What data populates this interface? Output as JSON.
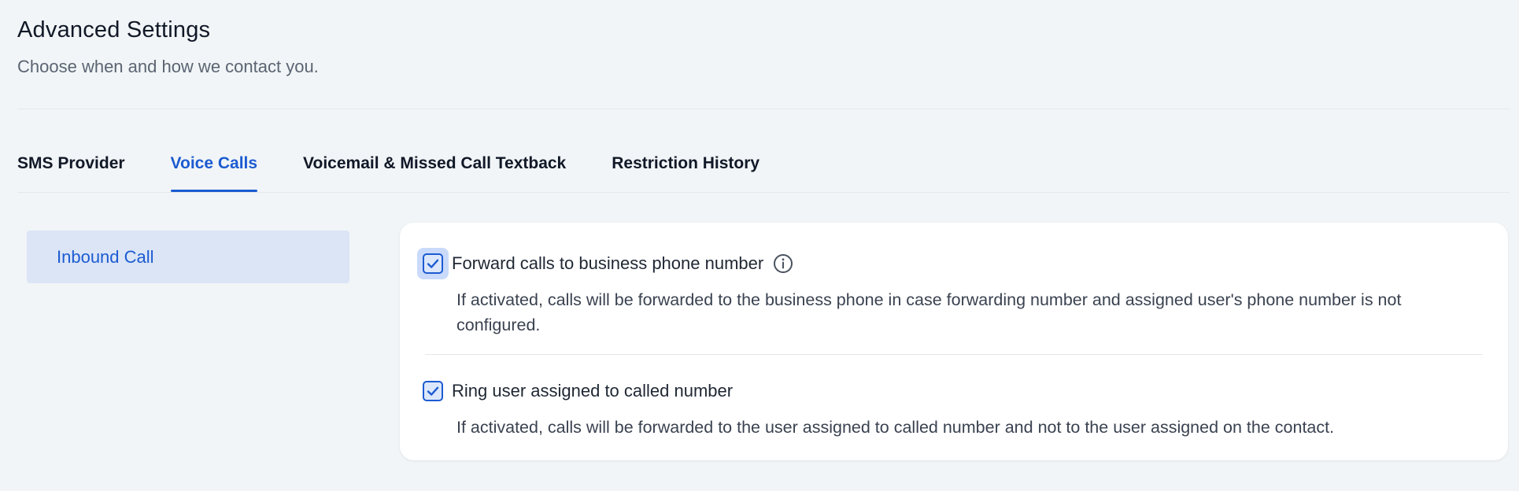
{
  "header": {
    "title": "Advanced Settings",
    "subtitle": "Choose when and how we contact you."
  },
  "tabs": [
    {
      "label": "SMS Provider",
      "active": false
    },
    {
      "label": "Voice Calls",
      "active": true
    },
    {
      "label": "Voicemail & Missed Call Textback",
      "active": false
    },
    {
      "label": "Restriction History",
      "active": false
    }
  ],
  "sidebar": {
    "items": [
      {
        "label": "Inbound Call",
        "selected": true
      }
    ]
  },
  "options": [
    {
      "label": "Forward calls to business phone number",
      "description": "If activated, calls will be forwarded to the business phone in case forwarding number and assigned user's phone number is not configured.",
      "checked": true,
      "has_info_icon": true
    },
    {
      "label": "Ring user assigned to called number",
      "description": "If activated, calls will be forwarded to the user assigned to called number and not to the user assigned on the contact.",
      "checked": true,
      "has_info_icon": false
    }
  ],
  "colors": {
    "accent": "#1c5bd1",
    "background": "#f1f5f7",
    "sidebar_selected_bg": "#dbe5f6"
  }
}
